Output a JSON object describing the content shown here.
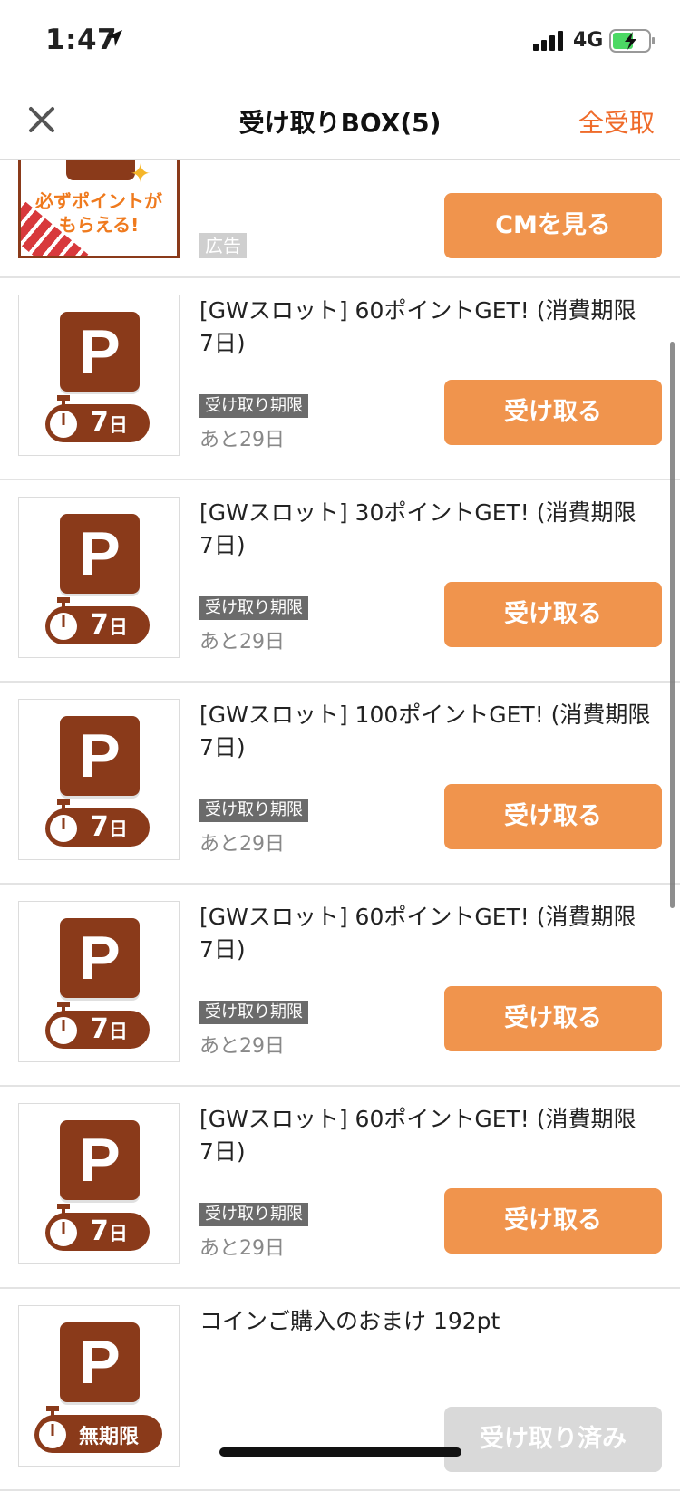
{
  "status_bar": {
    "time": "1:47",
    "network": "4G"
  },
  "nav": {
    "title": "受け取りBOX(5)",
    "receive_all": "全受取",
    "close_icon": "close-icon"
  },
  "ad": {
    "image_text_1": "必ずポイントが",
    "image_text_2": "もらえる!",
    "label": "広告",
    "button": "CMを見る"
  },
  "items": [
    {
      "title": "[GWスロット] 60ポイントGET! (消費期限 7日)",
      "badge_num": "7",
      "badge_unit": "日",
      "deadline_label": "受け取り期限",
      "remaining": "あと29日",
      "button": "受け取る"
    },
    {
      "title": "[GWスロット] 30ポイントGET! (消費期限 7日)",
      "badge_num": "7",
      "badge_unit": "日",
      "deadline_label": "受け取り期限",
      "remaining": "あと29日",
      "button": "受け取る"
    },
    {
      "title": "[GWスロット] 100ポイントGET! (消費期限 7日)",
      "badge_num": "7",
      "badge_unit": "日",
      "deadline_label": "受け取り期限",
      "remaining": "あと29日",
      "button": "受け取る"
    },
    {
      "title": "[GWスロット] 60ポイントGET! (消費期限 7日)",
      "badge_num": "7",
      "badge_unit": "日",
      "deadline_label": "受け取り期限",
      "remaining": "あと29日",
      "button": "受け取る"
    },
    {
      "title": "[GWスロット] 60ポイントGET! (消費期限 7日)",
      "badge_num": "7",
      "badge_unit": "日",
      "deadline_label": "受け取り期限",
      "remaining": "あと29日",
      "button": "受け取る"
    }
  ],
  "bonus_item": {
    "title": "コインご購入のおまけ 192pt",
    "badge": "無期限",
    "button": "受け取り済み"
  },
  "tile_letter": "P",
  "colors": {
    "accent": "#ef6b2a",
    "button": "#f0944d",
    "tile": "#8a3a1a",
    "disabled": "#d9d9d9"
  }
}
